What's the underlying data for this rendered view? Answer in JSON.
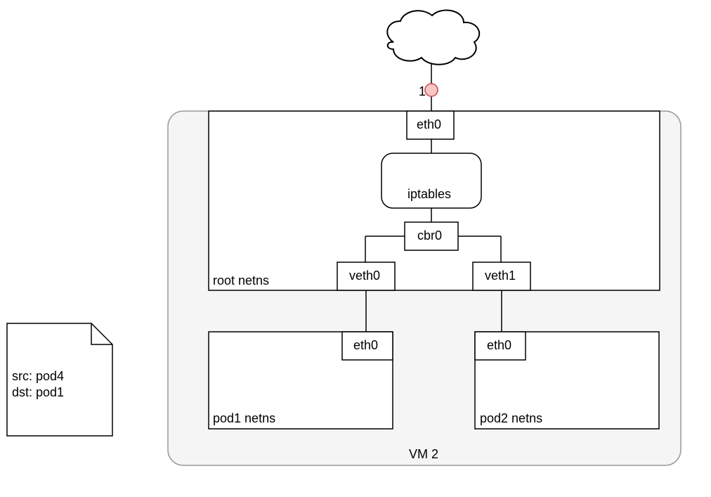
{
  "note": {
    "line1": "src: pod4",
    "line2": "dst: pod1"
  },
  "vm_label": "VM 2",
  "root_netns_label": "root netns",
  "eth0_top": "eth0",
  "iptables": "iptables",
  "cbr0": "cbr0",
  "veth0": "veth0",
  "veth1": "veth1",
  "pod1_eth0": "eth0",
  "pod2_eth0": "eth0",
  "pod1_netns": "pod1 netns",
  "pod2_netns": "pod2 netns",
  "marker_label": "1"
}
